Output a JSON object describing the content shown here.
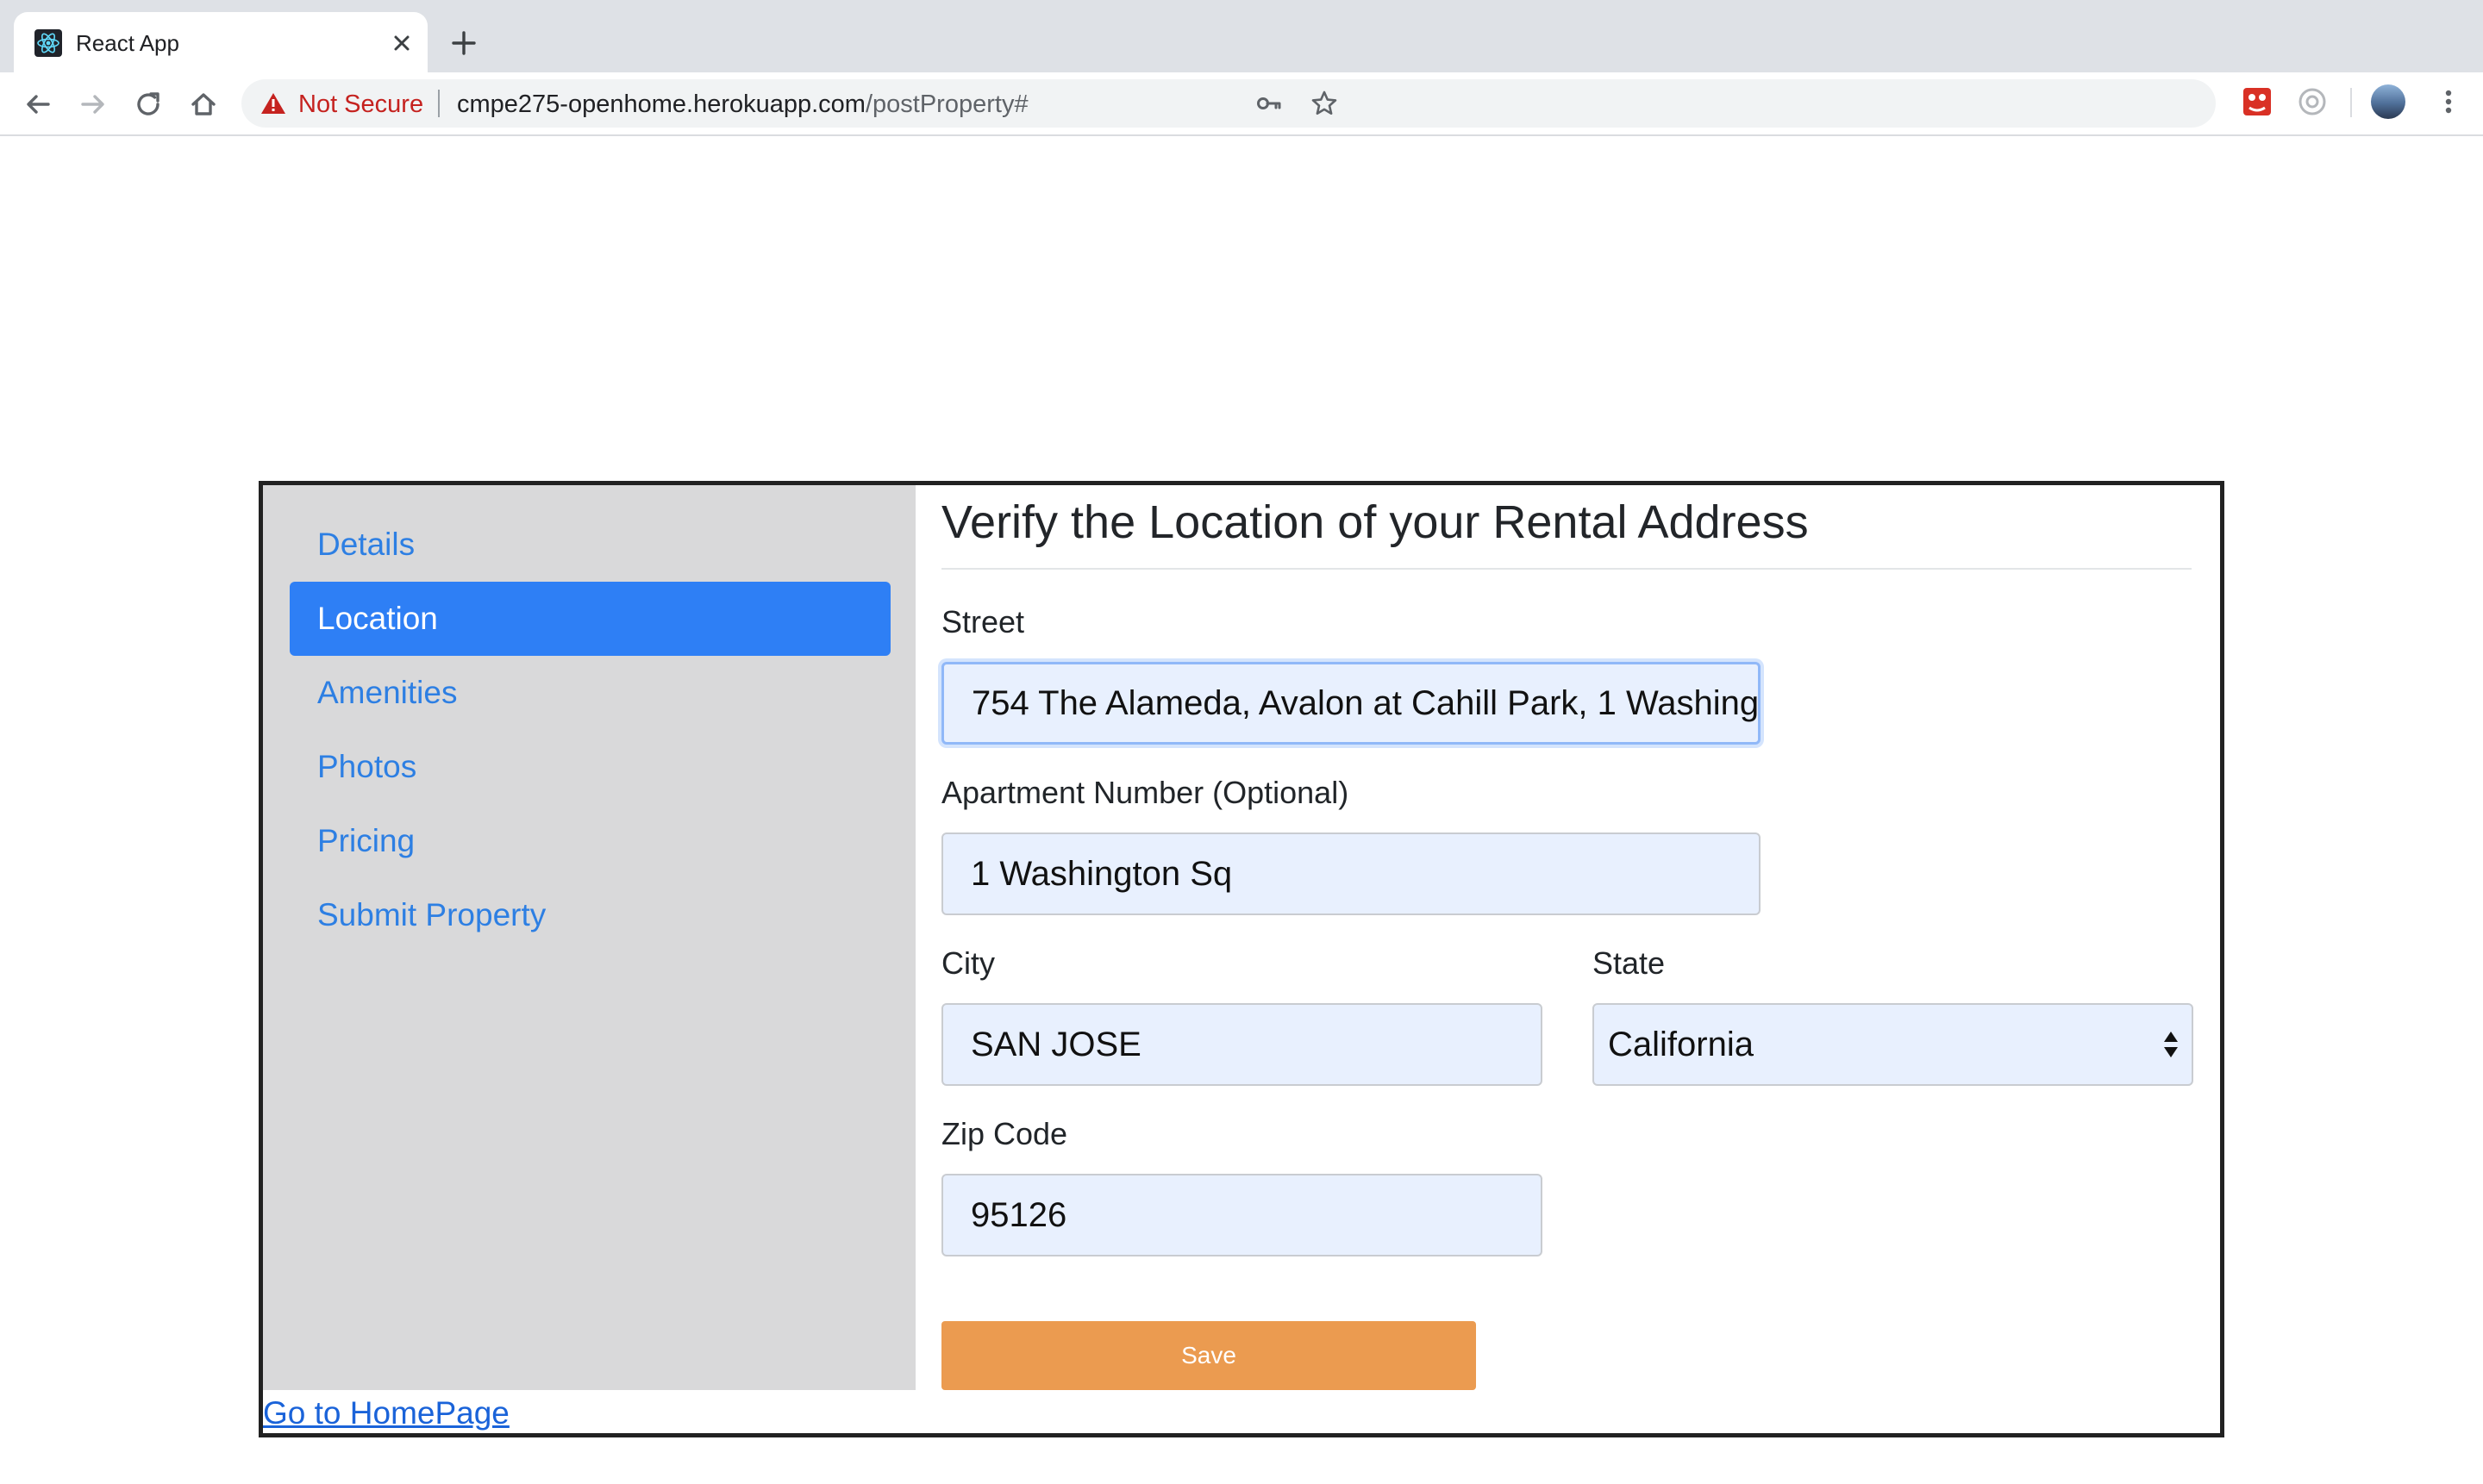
{
  "browser": {
    "tab_title": "React App",
    "security_label": "Not Secure",
    "url_host": "cmpe275-openhome.herokuapp.com",
    "url_path": "/postProperty#"
  },
  "sidebar": {
    "items": [
      {
        "label": "Details",
        "active": false
      },
      {
        "label": "Location",
        "active": true
      },
      {
        "label": "Amenities",
        "active": false
      },
      {
        "label": "Photos",
        "active": false
      },
      {
        "label": "Pricing",
        "active": false
      },
      {
        "label": "Submit Property",
        "active": false
      }
    ],
    "active_color": "#2e7ff5",
    "link_color": "#2d7fe3"
  },
  "home_link": "Go to HomePage",
  "form": {
    "heading": "Verify the Location of your Rental Address",
    "street": {
      "label": "Street",
      "value": "754 The Alameda, Avalon at Cahill Park, 1 Washing"
    },
    "apartment": {
      "label": "Apartment Number (Optional)",
      "value": "1 Washington Sq"
    },
    "city": {
      "label": "City",
      "value": "SAN JOSE"
    },
    "state": {
      "label": "State",
      "value": "California"
    },
    "zip": {
      "label": "Zip Code",
      "value": "95126"
    },
    "save_label": "Save",
    "save_color": "#eb9b50"
  }
}
